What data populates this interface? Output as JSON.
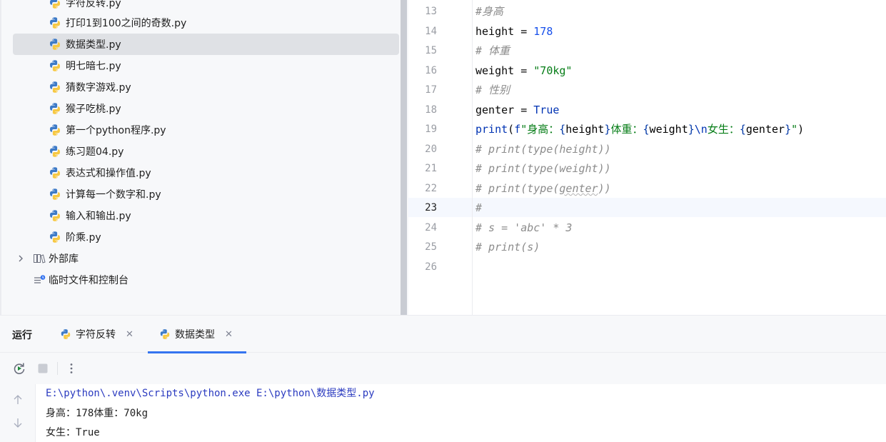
{
  "project_tree": {
    "top_partial_file": "字符反转.py",
    "files": [
      {
        "label": "打印1到100之间的奇数.py"
      },
      {
        "label": "数据类型.py",
        "selected": true
      },
      {
        "label": "明七暗七.py"
      },
      {
        "label": "猜数字游戏.py"
      },
      {
        "label": "猴子吃桃.py"
      },
      {
        "label": "第一个python程序.py"
      },
      {
        "label": "练习题04.py"
      },
      {
        "label": "表达式和操作值.py"
      },
      {
        "label": "计算每一个数字和.py"
      },
      {
        "label": "输入和输出.py"
      },
      {
        "label": "阶乘.py"
      }
    ],
    "external_libraries": "外部库",
    "scratches": "临时文件和控制台"
  },
  "editor": {
    "current_line": "23",
    "lines": [
      {
        "n": "13",
        "text": "#身高"
      },
      {
        "n": "14",
        "text": "height = 178"
      },
      {
        "n": "15",
        "text": "# 体重"
      },
      {
        "n": "16",
        "text": "weight = \"70kg\""
      },
      {
        "n": "17",
        "text": "# 性别"
      },
      {
        "n": "18",
        "text": "genter = True"
      },
      {
        "n": "19",
        "text": "print(f\"身高：{height}体重：{weight}\\n女生：{genter}\")"
      },
      {
        "n": "20",
        "text": "# print(type(height))"
      },
      {
        "n": "21",
        "text": "# print(type(weight))"
      },
      {
        "n": "22",
        "text": "# print(type(genter))"
      },
      {
        "n": "23",
        "text": "#"
      },
      {
        "n": "24",
        "text": "# s = 'abc' * 3"
      },
      {
        "n": "25",
        "text": "# print(s)"
      },
      {
        "n": "26",
        "text": ""
      }
    ]
  },
  "run_panel": {
    "title": "运行",
    "tabs": [
      {
        "label": "字符反转",
        "active": false
      },
      {
        "label": "数据类型",
        "active": true
      }
    ],
    "console": [
      "E:\\python\\.venv\\Scripts\\python.exe E:\\python\\数据类型.py",
      "身高：178体重：70kg",
      "女生：True"
    ]
  },
  "colors": {
    "accent": "#3574f0",
    "selected_row": "#dfe1e5",
    "comment": "#8c8c8c",
    "number": "#1750eb",
    "string": "#067d17",
    "keyword": "#0033b3"
  },
  "icons": [
    "python-file-icon",
    "chevron-right-icon",
    "library-icon",
    "scratches-icon",
    "rerun-icon",
    "stop-icon",
    "more-options-icon",
    "close-icon",
    "scroll-up-icon",
    "scroll-down-icon"
  ]
}
